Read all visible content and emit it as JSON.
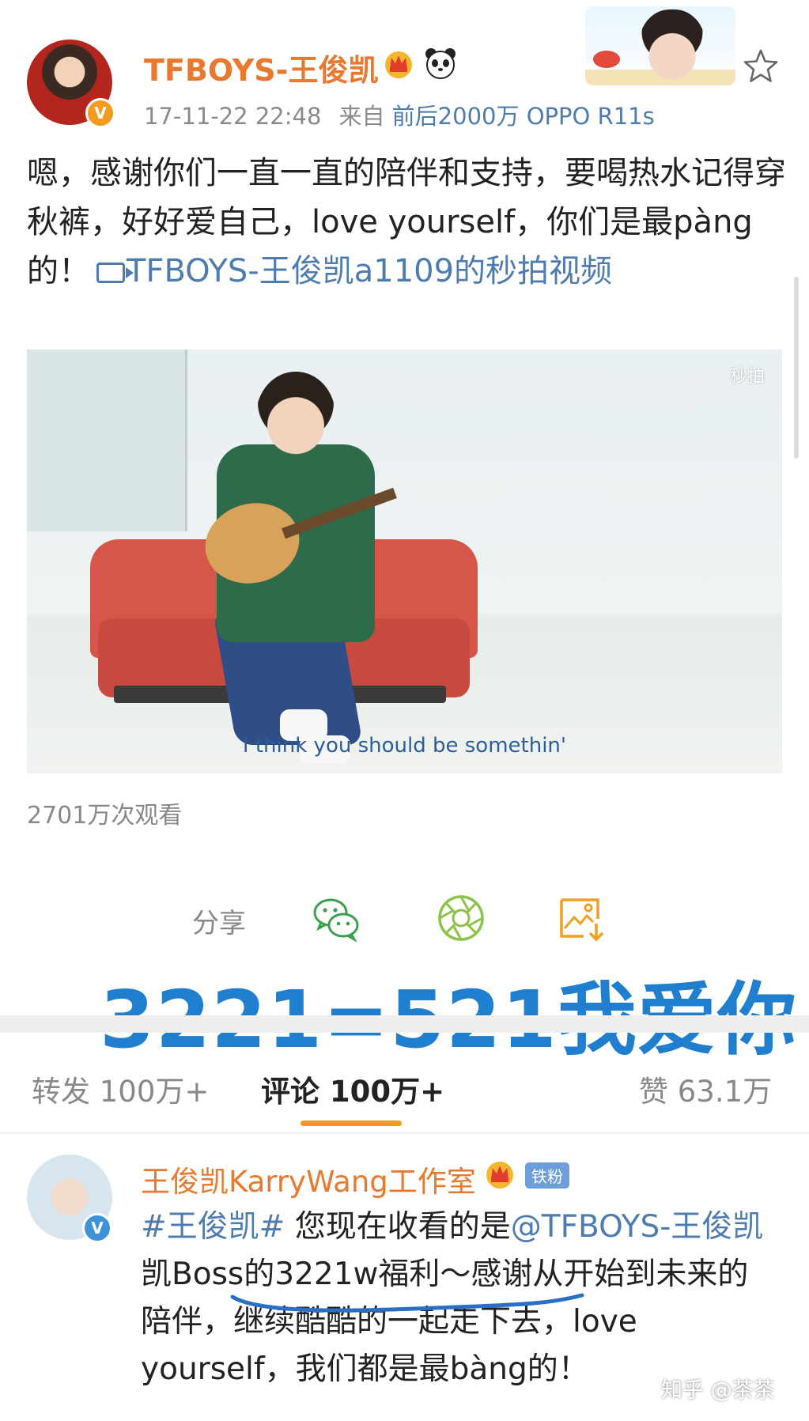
{
  "post": {
    "username": "TFBOYS-王俊凯",
    "timestamp": "17-11-22 22:48",
    "source_prefix": "来自",
    "device": "前后2000万 OPPO R11s",
    "text_plain": "嗯，感谢你们一直一直的陪伴和支持，要喝热水记得穿秋裤，好好爱自己，love yourself，你们是最pàng的！",
    "text_link": "TFBOYS-王俊凯a1109的秒拍视频",
    "verified_badge": "V",
    "icons": [
      "crown-icon",
      "panda-icon",
      "star-icon",
      "video-link-icon"
    ]
  },
  "video": {
    "watermark": "秒拍",
    "subtitle": "I think you should be somethin'"
  },
  "views": "2701万次观看",
  "share": {
    "label": "分享",
    "icons": [
      "wechat-icon",
      "moments-icon",
      "save-image-icon"
    ]
  },
  "overlay": {
    "headline": "3221=521我爱你"
  },
  "tabs": {
    "repost": "转发 100万+",
    "comment": "评论 100万+",
    "like": "赞 63.1万"
  },
  "comment": {
    "name": "王俊凯KarryWang工作室",
    "fan_badge": "铁粉",
    "verified_badge": "V",
    "hashtag": "#王俊凯#",
    "text_a": " 您现在收看的是",
    "mention": "@TFBOYS-王俊凯",
    "text_b": " 凯Boss的3221w福利～感谢从开始到未来的陪伴，继续酷酷的一起走下去，love yourself，我们都是最bàng的！"
  },
  "watermark": "知乎 @茶茶",
  "colors": {
    "username_orange": "#e8792e",
    "link_blue": "#4f7cae",
    "headline_blue": "#1f7fce",
    "tab_underline": "#f59a1c",
    "comment_verified": "#3f91d8"
  }
}
